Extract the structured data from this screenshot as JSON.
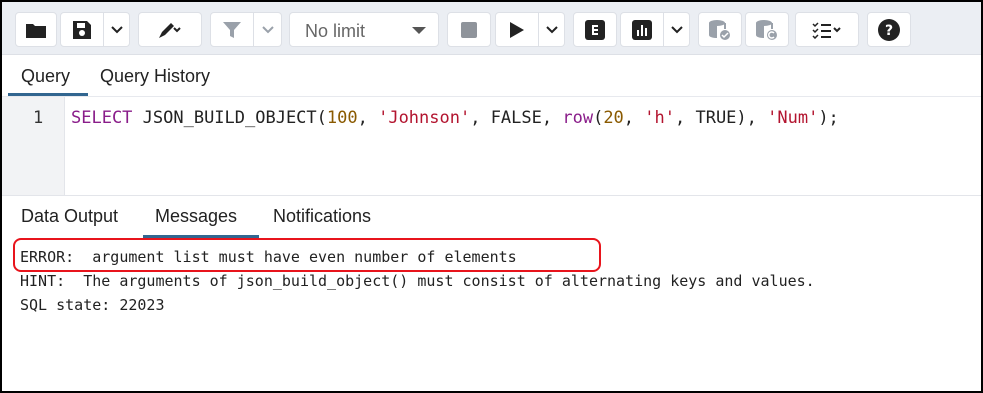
{
  "toolbar": {
    "limit_value": "No limit",
    "icons": [
      "folder-icon",
      "save-icon",
      "chevron-down-icon",
      "edit-icon",
      "filter-icon",
      "stop-icon",
      "play-icon",
      "explain-icon",
      "chart-icon",
      "commit-icon",
      "rollback-icon",
      "macros-icon",
      "help-icon"
    ]
  },
  "query_tabs": {
    "query": "Query",
    "history": "Query History"
  },
  "editor": {
    "line_number": "1",
    "code_tokens": [
      {
        "t": "SELECT",
        "c": "kw"
      },
      {
        "t": " JSON_BUILD_OBJECT(",
        "c": "fn"
      },
      {
        "t": "100",
        "c": "num"
      },
      {
        "t": ", ",
        "c": "fn"
      },
      {
        "t": "'Johnson'",
        "c": "str"
      },
      {
        "t": ", FALSE, ",
        "c": "fn"
      },
      {
        "t": "row",
        "c": "kw"
      },
      {
        "t": "(",
        "c": "fn"
      },
      {
        "t": "20",
        "c": "num"
      },
      {
        "t": ", ",
        "c": "fn"
      },
      {
        "t": "'h'",
        "c": "str"
      },
      {
        "t": ", TRUE), ",
        "c": "fn"
      },
      {
        "t": "'Num'",
        "c": "str"
      },
      {
        "t": ");",
        "c": "fn"
      }
    ]
  },
  "output_tabs": {
    "data_output": "Data Output",
    "messages": "Messages",
    "notifications": "Notifications"
  },
  "messages": {
    "error": "ERROR:  argument list must have even number of elements",
    "hint": "HINT:  The arguments of json_build_object() must consist of alternating keys and values.",
    "state": "SQL state: 22023"
  },
  "colors": {
    "accent": "#326690",
    "error_outline": "#e8141c"
  }
}
